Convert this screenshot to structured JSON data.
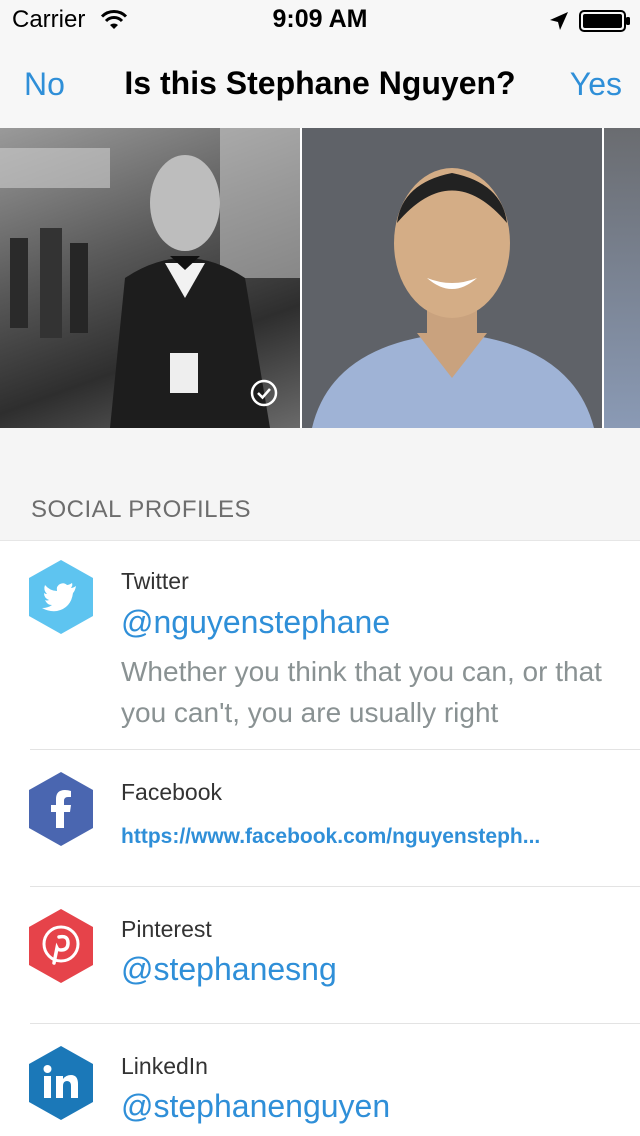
{
  "status_bar": {
    "carrier": "Carrier",
    "time": "9:09 AM",
    "icons": [
      "wifi-icon",
      "location-arrow-icon",
      "battery-icon"
    ]
  },
  "nav": {
    "no_label": "No",
    "title": "Is this Stephane Nguyen?",
    "yes_label": "Yes"
  },
  "photos": [
    {
      "name": "photo-golden-globe",
      "selected": true
    },
    {
      "name": "photo-portrait",
      "selected": false
    },
    {
      "name": "photo-partial",
      "selected": false
    }
  ],
  "social": {
    "section_title": "SOCIAL PROFILES",
    "profiles": [
      {
        "network": "Twitter",
        "handle": "@nguyenstephane",
        "bio": "Whether you think that you can, or that you can't, you are usually right",
        "color": "#5ec4f0",
        "icon": "twitter-bird-icon"
      },
      {
        "network": "Facebook",
        "url": "https://www.facebook.com/nguyensteph...",
        "color": "#4a66b0",
        "icon": "facebook-f-icon"
      },
      {
        "network": "Pinterest",
        "handle": "@stephanesng",
        "color": "#e6434a",
        "icon": "pinterest-p-icon"
      },
      {
        "network": "LinkedIn",
        "handle": "@stephanenguyen",
        "color": "#1b78b8",
        "icon": "linkedin-in-icon"
      }
    ]
  }
}
